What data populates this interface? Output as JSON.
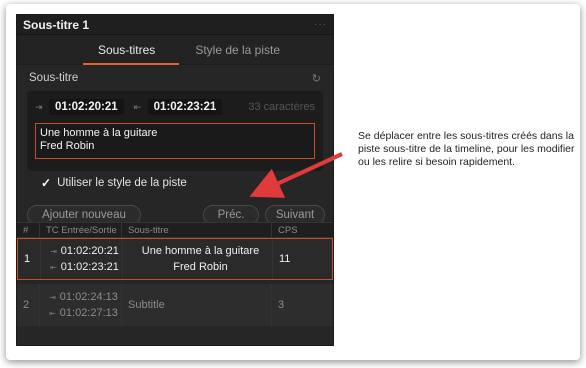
{
  "panel": {
    "title": "Sous-titre 1",
    "more": "···",
    "tabs": [
      {
        "label": "Sous-titres"
      },
      {
        "label": "Style de la piste"
      }
    ],
    "section_label": "Sous-titre",
    "editor": {
      "tc_in": "01:02:20:21",
      "tc_out": "01:02:23:21",
      "char_count": "33 caractères",
      "text_line1": "Une homme à la guitare",
      "text_line2": "Fred Robin"
    },
    "use_track_style_label": "Utiliser le style de la piste",
    "buttons": {
      "add": "Ajouter nouveau",
      "prev": "Préc.",
      "next": "Suivant"
    },
    "table": {
      "headers": [
        "#",
        "TC Entrée/Sortie",
        "Sous-titre",
        "CPS"
      ],
      "rows": [
        {
          "num": "1",
          "tc_in": "01:02:20:21",
          "tc_out": "01:02:23:21",
          "text1": "Une homme à la guitare",
          "text2": "Fred Robin",
          "cps": "11"
        },
        {
          "num": "2",
          "tc_in": "01:02:24:13",
          "tc_out": "01:02:27:13",
          "text1": "Subtitle",
          "text2": "",
          "cps": "3"
        }
      ]
    }
  },
  "annotation": "Se déplacer entre les sous-titres créés dans la piste sous-titre de la timeline, pour les modifier ou les relire si besoin rapidement.",
  "colors": {
    "accent": "#e2622f",
    "arrow": "#e03a3a"
  }
}
